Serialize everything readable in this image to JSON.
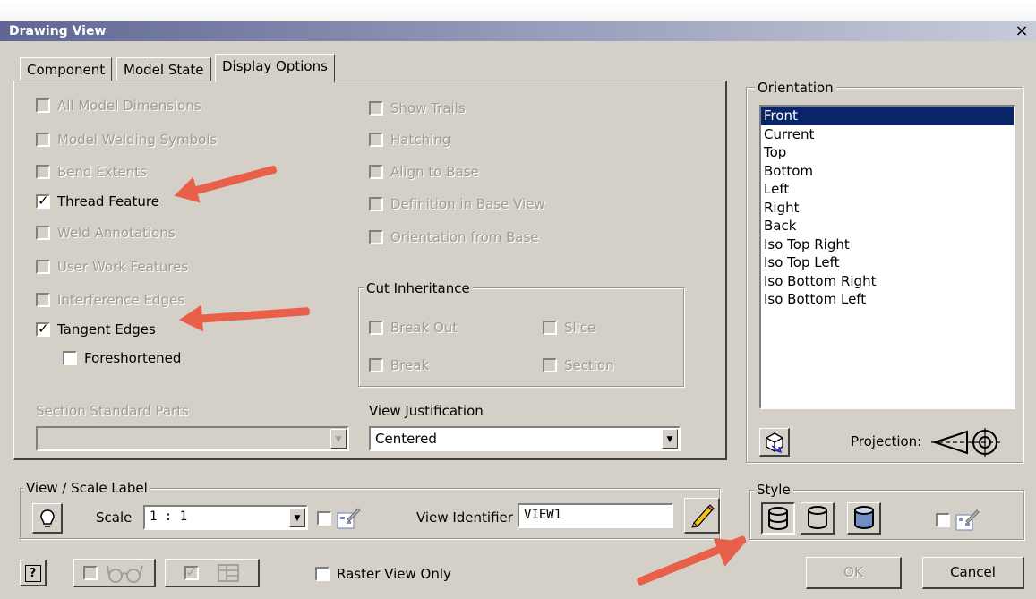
{
  "window": {
    "title": "Drawing View",
    "close": "×"
  },
  "tabs": [
    {
      "label": "Component",
      "active": false
    },
    {
      "label": "Model State",
      "active": false
    },
    {
      "label": "Display Options",
      "active": true
    }
  ],
  "left_checks": [
    {
      "label": "All Model Dimensions",
      "checked": false,
      "enabled": false
    },
    {
      "label": "Model Welding Symbols",
      "checked": false,
      "enabled": false
    },
    {
      "label": "Bend Extents",
      "checked": false,
      "enabled": false
    },
    {
      "label": "Thread Feature",
      "checked": true,
      "enabled": true
    },
    {
      "label": "Weld Annotations",
      "checked": false,
      "enabled": false
    },
    {
      "label": "User Work Features",
      "checked": false,
      "enabled": false
    },
    {
      "label": "Interference Edges",
      "checked": false,
      "enabled": false
    },
    {
      "label": "Tangent Edges",
      "checked": true,
      "enabled": true
    },
    {
      "label": "Foreshortened",
      "checked": false,
      "enabled": true
    }
  ],
  "right_checks": [
    {
      "label": "Show Trails",
      "checked": false,
      "enabled": false
    },
    {
      "label": "Hatching",
      "checked": false,
      "enabled": false
    },
    {
      "label": "Align to Base",
      "checked": false,
      "enabled": false
    },
    {
      "label": "Definition in Base View",
      "checked": false,
      "enabled": false
    },
    {
      "label": "Orientation from Base",
      "checked": false,
      "enabled": false
    }
  ],
  "cut_inheritance": {
    "title": "Cut Inheritance",
    "items": [
      {
        "label": "Break Out",
        "checked": false,
        "enabled": false
      },
      {
        "label": "Slice",
        "checked": false,
        "enabled": false
      },
      {
        "label": "Break",
        "checked": false,
        "enabled": false
      },
      {
        "label": "Section",
        "checked": false,
        "enabled": false
      }
    ]
  },
  "section_standard_parts": {
    "label": "Section Standard Parts",
    "value": ""
  },
  "view_justification": {
    "label": "View Justification",
    "value": "Centered"
  },
  "orientation": {
    "title": "Orientation",
    "items": [
      "Front",
      "Current",
      "Top",
      "Bottom",
      "Left",
      "Right",
      "Back",
      "Iso Top Right",
      "Iso Top Left",
      "Iso Bottom Right",
      "Iso Bottom Left"
    ],
    "selected": "Front",
    "projection_label": "Projection:"
  },
  "view_scale": {
    "title": "View / Scale Label",
    "scale_label": "Scale",
    "scale_value": "1 : 1",
    "identifier_label": "View Identifier",
    "identifier_value": "VIEW1"
  },
  "style": {
    "title": "Style"
  },
  "bottom": {
    "help": "?",
    "raster_label": "Raster View Only",
    "ok": "OK",
    "cancel": "Cancel"
  },
  "colors": {
    "accent_arrow": "#e8604a",
    "selection": "#0a246a",
    "dialog_bg": "#d4d0c8"
  }
}
